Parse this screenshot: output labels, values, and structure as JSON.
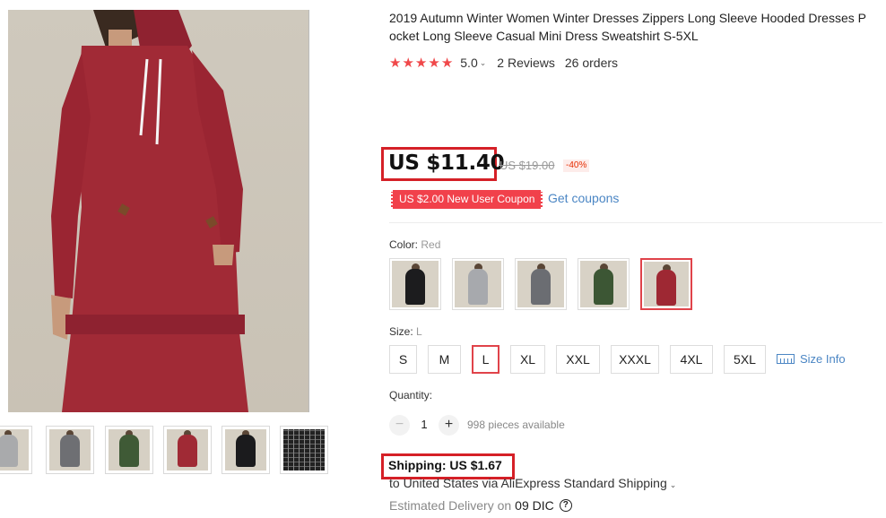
{
  "product": {
    "title": "2019 Autumn Winter Women Winter Dresses Zippers Long Sleeve Hooded Dresses P\nocket Long Sleeve Casual Mini Dress Sweatshirt S-5XL",
    "rating": "5.0",
    "reviews": "2 Reviews",
    "orders": "26 orders",
    "price": "US $11.40",
    "original_price": "US $19.00",
    "discount": "-40%",
    "coupon": "US $2.00 New User Coupon",
    "get_coupons": "Get coupons"
  },
  "gallery": {
    "main_image": "red-hooded-dress-photo",
    "thumbnails": [
      {
        "name": "light-gray",
        "color": "#a9aaac"
      },
      {
        "name": "gray",
        "color": "#6e6f73"
      },
      {
        "name": "green",
        "color": "#3f5a36"
      },
      {
        "name": "red",
        "color": "#a02a35"
      },
      {
        "name": "black",
        "color": "#1b1b1d"
      },
      {
        "name": "size-chart",
        "color": "#222222"
      }
    ]
  },
  "color": {
    "label": "Color:",
    "selected": "Red",
    "options": [
      {
        "name": "black",
        "color": "#1c1c1e"
      },
      {
        "name": "light-gray",
        "color": "#a7a9ad"
      },
      {
        "name": "gray",
        "color": "#6b6d72"
      },
      {
        "name": "green",
        "color": "#3c5634"
      },
      {
        "name": "red",
        "color": "#9e2833"
      }
    ],
    "selected_index": 4
  },
  "size": {
    "label": "Size:",
    "selected": "L",
    "options": [
      "S",
      "M",
      "L",
      "XL",
      "XXL",
      "XXXL",
      "4XL",
      "5XL"
    ],
    "selected_index": 2,
    "size_info": "Size Info"
  },
  "quantity": {
    "label": "Quantity:",
    "value": "1",
    "minus": "−",
    "plus": "+",
    "available": "998 pieces available"
  },
  "shipping": {
    "label": "Shipping: US $1.67",
    "destination": "to United States via AliExpress Standard Shipping",
    "delivery_prefix": "Estimated Delivery on",
    "delivery_date": "09 DIC",
    "help_icon": "?"
  },
  "colors": {
    "accent_red": "#d52027",
    "star_red": "#f0484a",
    "link_blue": "#4b86c4",
    "coupon_red": "#f1414b"
  }
}
